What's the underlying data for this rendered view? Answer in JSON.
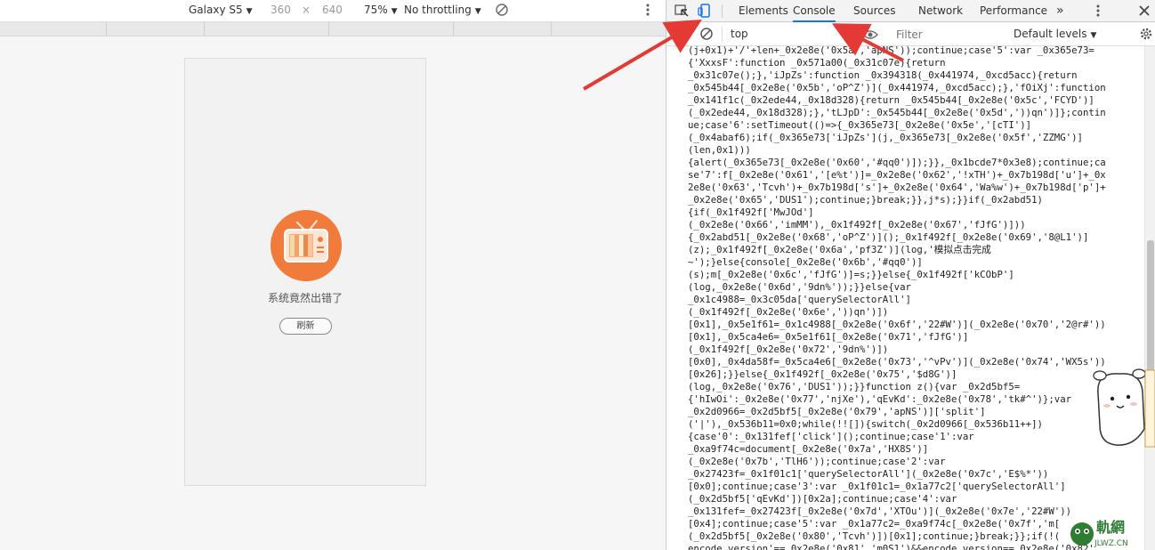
{
  "device_toolbar": {
    "device_name": "Galaxy S5",
    "width": "360",
    "times": "×",
    "height": "640",
    "zoom": "75%",
    "throttling": "No throttling"
  },
  "emulated_page": {
    "error_message": "系统竟然出错了",
    "refresh_label": "刷新"
  },
  "devtools": {
    "tabs": [
      "Elements",
      "Console",
      "Sources",
      "Network",
      "Performance"
    ],
    "active_tab": "Console",
    "more_tabs": "»",
    "context": "top",
    "filter_placeholder": "Filter",
    "log_levels": "Default levels"
  },
  "console_lines": [
    "(j+0x1)+'/'+len+_0x2e8e('0x5a','apNS'));continue;case'5':var _0x365e73=",
    "{'XxxsF':function _0x571a00(_0x31c07e){return",
    "_0x31c07e();},'iJpZs':function _0x394318(_0x441974,_0xcd5acc){return",
    "_0x545b44[_0x2e8e('0x5b','oP^Z')](_0x441974,_0xcd5acc);},'fOiXj':function",
    "_0x141f1c(_0x2ede44,_0x18d328){return _0x545b44[_0x2e8e('0x5c','FCYD')]",
    "(_0x2ede44,_0x18d328);},'tLJpD':_0x545b44[_0x2e8e('0x5d','))qn')]};contin",
    "ue;case'6':setTimeout(()=>{_0x365e73[_0x2e8e('0x5e','[cTI')]",
    "(_0x4abaf6);if(_0x365e73['iJpZs'](j,_0x365e73[_0x2e8e('0x5f','ZZMG')]",
    "(len,0x1)))",
    "{alert(_0x365e73[_0x2e8e('0x60','#qq0')]);}},_0x1bcde7*0x3e8);continue;ca",
    "se'7':f[_0x2e8e('0x61','[e%t')]=_0x2e8e('0x62','!xTH')+_0x7b198d['u']+_0x",
    "2e8e('0x63','Tcvh')+_0x7b198d['s']+_0x2e8e('0x64','Wa%w')+_0x7b198d['p']+",
    "_0x2e8e('0x65','DUS1');continue;}break;}},j*s);}}if(_0x2abd51)",
    "{if(_0x1f492f['MwJOd']",
    "(_0x2e8e('0x66','imMM'),_0x1f492f[_0x2e8e('0x67','fJfG')]))",
    "{_0x2abd51[_0x2e8e('0x68','oP^Z')]();_0x1f492f[_0x2e8e('0x69','8@L1')]",
    "(z);_0x1f492f[_0x2e8e('0x6a','pf3Z')](log,'模拟点击完成",
    "~');}else{console[_0x2e8e('0x6b','#qq0')]",
    "(s);m[_0x2e8e('0x6c','fJfG')]=s;}}else{_0x1f492f['kCObP']",
    "(log,_0x2e8e('0x6d','9dn%'));}}else{var",
    "_0x1c4988=_0x3c05da['querySelectorAll']",
    "(_0x1f492f[_0x2e8e('0x6e','))qn')])",
    "[0x1],_0x5e1f61=_0x1c4988[_0x2e8e('0x6f','22#W')](_0x2e8e('0x70','2@r#'))",
    "[0x1],_0x5ca4e6=_0x5e1f61[_0x2e8e('0x71','fJfG')]",
    "(_0x1f492f[_0x2e8e('0x72','9dn%')])",
    "[0x0],_0x4da58f=_0x5ca4e6[_0x2e8e('0x73','^vPv')](_0x2e8e('0x74','WX5s'))",
    "[0x26];}}else{_0x1f492f[_0x2e8e('0x75','$d8G')]",
    "(log,_0x2e8e('0x76','DUS1'));}}function z(){var _0x2d5bf5=",
    "{'hIwOi':_0x2e8e('0x77','njXe'),'qEvKd':_0x2e8e('0x78','tk#^')};var",
    "_0x2d0966=_0x2d5bf5[_0x2e8e('0x79','apNS')]['split']",
    "('|'),_0x536b11=0x0;while(!![]){switch(_0x2d0966[_0x536b11++])",
    "{case'0':_0x131fef['click']();continue;case'1':var",
    "_0xa9f74c=document[_0x2e8e('0x7a','HX8S')]",
    "(_0x2e8e('0x7b','TlH6'));continue;case'2':var",
    "_0x27423f=_0x1f01c1['querySelectorAll'](_0x2e8e('0x7c','E$%*'))",
    "[0x0];continue;case'3':var _0x1f01c1=_0x1a77c2['querySelectorAll']",
    "(_0x2d5bf5['qEvKd'])[0x2a];continue;case'4':var",
    "_0x131fef=_0x27423f[_0x2e8e('0x7d','XTOu')](_0x2e8e('0x7e','22#W'))",
    "[0x4];continue;case'5':var _0x1a77c2=_0xa9f74c[_0x2e8e('0x7f','m[",
    "(_0x2d5bf5[_0x2e8e('0x80','Tcvh')])[0x1];continue;}break;}};if(!(",
    "encode_version'== 0x2e8e('0x81','m0S1')&&encode_version== 0x2e8e('0x82'"
  ],
  "scrollbar": {
    "position": 0.55,
    "visible_fraction": 0.3
  },
  "watermark": {
    "text": "JLWZ.CN",
    "logo_text": "軌網"
  },
  "colors": {
    "annotation_arrow": "#e53935",
    "active_tab_underline": "#1a73e8",
    "tv_icon_bg": "#f07b3a"
  }
}
